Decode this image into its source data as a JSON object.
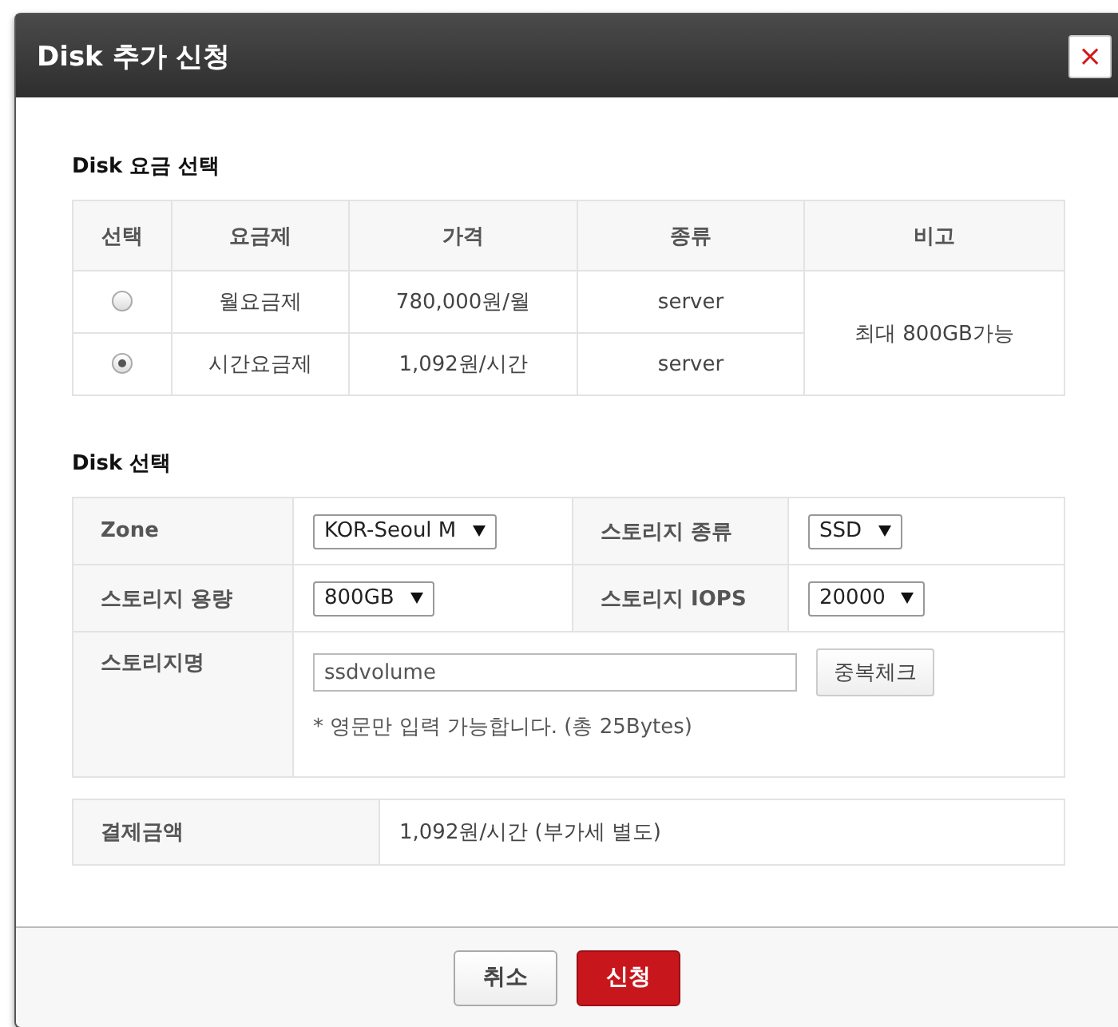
{
  "window": {
    "title": "Disk 추가 신청",
    "close": "×"
  },
  "rate_section": {
    "title": "Disk 요금 선택",
    "columns": [
      "선택",
      "요금제",
      "가격",
      "종류",
      "비고"
    ],
    "rows": [
      {
        "selected": false,
        "plan": "월요금제",
        "price": "780,000원/월",
        "type": "server"
      },
      {
        "selected": true,
        "plan": "시간요금제",
        "price": "1,092원/시간",
        "type": "server"
      }
    ],
    "note": "최대 800GB가능"
  },
  "disk_section": {
    "title": "Disk 선택",
    "fields": [
      {
        "label": "Zone",
        "value": "KOR-Seoul M"
      },
      {
        "label": "스토리지 종류",
        "value": "SSD"
      },
      {
        "label": "스토리지 용량",
        "value": "800GB"
      },
      {
        "label": "스토리지 IOPS",
        "value": "20000"
      }
    ],
    "name": {
      "label": "스토리지명",
      "value": "ssdvolume",
      "check_button": "중복체크",
      "hint": "* 영문만 입력 가능합니다. (총 25Bytes)"
    }
  },
  "payment": {
    "label": "결제금액",
    "value": "1,092원/시간 (부가세 별도)"
  },
  "buttons": [
    {
      "label": "취소",
      "kind": "secondary"
    },
    {
      "label": "신청",
      "kind": "primary"
    }
  ]
}
